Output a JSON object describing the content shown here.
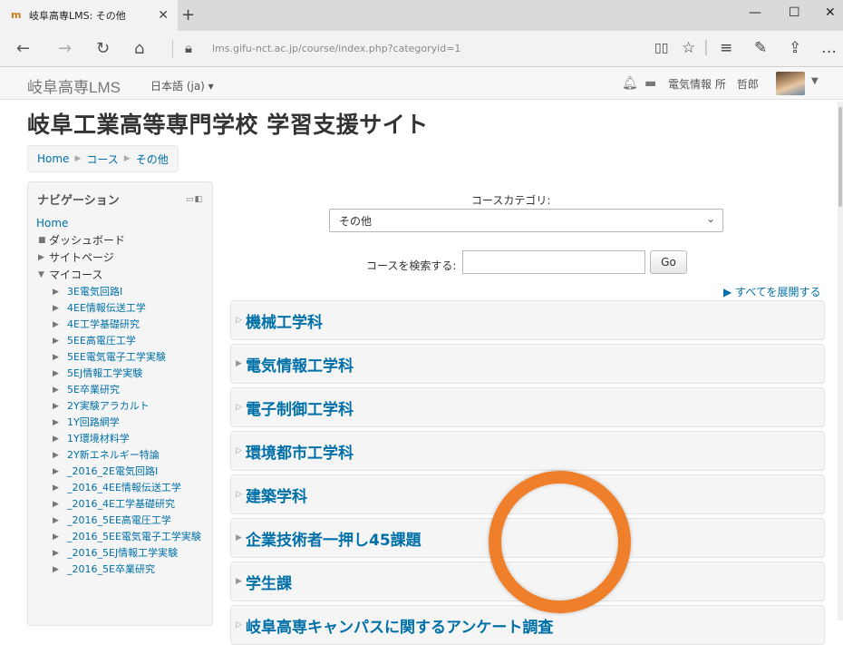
{
  "browser": {
    "tab_title": "岐阜高専LMS: その他",
    "tab_close": "✕",
    "new_tab": "+",
    "url": "lms.gifu-nct.ac.jp/course/index.php?categoryid=1",
    "window_controls": [
      "—",
      "☐",
      "✕"
    ],
    "icons": [
      "back-icon",
      "forward-icon",
      "refresh-icon",
      "home-icon",
      "lock-icon",
      "reading-view-icon",
      "favorite-star-icon",
      "hub-icon",
      "notes-icon",
      "share-icon",
      "more-icon"
    ]
  },
  "moodle_nav": {
    "brand": "岐阜高専LMS",
    "language": "日本語 (ja) ▾",
    "user_name": "電気情報 所　哲郎",
    "icons": [
      "notifications-bell-icon",
      "messages-icon"
    ]
  },
  "page": {
    "title": "岐阜工業高等専門学校 学習支援サイト",
    "breadcrumb": [
      "Home",
      "コース",
      "その他"
    ]
  },
  "navigation": {
    "title": "ナビゲーション",
    "home": "Home",
    "items": [
      {
        "marker": "■",
        "label": "ダッシュボード"
      },
      {
        "marker": "▶",
        "label": "サイトページ"
      },
      {
        "marker": "▼",
        "label": "マイコース"
      }
    ],
    "courses": [
      "3E電気回路I",
      "4EE情報伝送工学",
      "4E工学基礎研究",
      "5EE高電圧工学",
      "5EE電気電子工学実験",
      "5EJ情報工学実験",
      "5E卒業研究",
      "2Y実験アラカルト",
      "1Y回路網学",
      "1Y環境材料学",
      "2Y新エネルギー特論",
      "_2016_2E電気回路I",
      "_2016_4EE情報伝送工学",
      "_2016_4E工学基礎研究",
      "_2016_5EE高電圧工学",
      "_2016_5EE電気電子工学実験",
      "_2016_5EJ情報工学実験",
      "_2016_5E卒業研究"
    ]
  },
  "main": {
    "category_label": "コースカテゴリ:",
    "category_selected": "その他",
    "search_label": "コースを検索する:",
    "search_value": "",
    "go_button": "Go",
    "expand_all": "▶ すべてを展開する",
    "categories": [
      "機械工学科",
      "電気情報工学科",
      "電子制御工学科",
      "環境都市工学科",
      "建築学科",
      "企業技術者一押し45課題",
      "学生課",
      "岐阜高専キャンパスに関するアンケート調査"
    ]
  },
  "colors": {
    "link": "#0070a8",
    "ring": "#ef7f2a",
    "block_bg": "#f5f5f5"
  }
}
